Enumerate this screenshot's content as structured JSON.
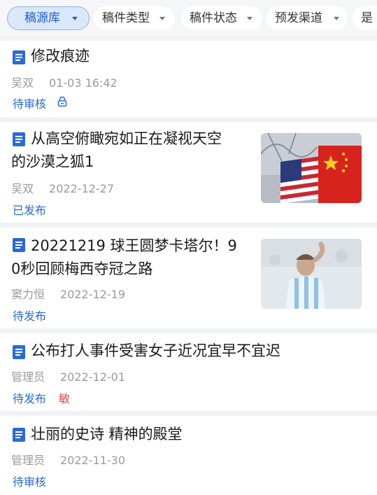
{
  "filters": [
    {
      "label": "稿源库",
      "active": true
    },
    {
      "label": "稿件类型",
      "active": false
    },
    {
      "label": "稿件状态",
      "active": false
    },
    {
      "label": "预发渠道",
      "active": false
    },
    {
      "label": "是",
      "active": false
    }
  ],
  "articles": [
    {
      "title_lines": [
        "修改痕迹"
      ],
      "author": "吴双",
      "date": "01-03 16:42",
      "status": "待审核",
      "locked": true
    },
    {
      "title_lines": [
        "从高空俯瞰宛如正在凝视天空",
        "的沙漠之狐1"
      ],
      "author": "吴双",
      "date": "2022-12-27",
      "status": "已发布",
      "thumbnail": "flags-photo"
    },
    {
      "title_lines": [
        "20221219 球王圆梦卡塔尔！9",
        "0秒回顾梅西夺冠之路"
      ],
      "author": "窦力恒",
      "date": "2022-12-19",
      "status": "待发布",
      "thumbnail": "player-photo"
    },
    {
      "title_lines": [
        "公布打人事件受害女子近况宜早不宜迟"
      ],
      "author": "管理员",
      "date": "2022-12-01",
      "status": "待发布",
      "sensitive_label": "敏"
    },
    {
      "title_lines": [
        "壮丽的史诗 精神的殿堂"
      ],
      "author": "管理员",
      "date": "2022-11-30",
      "status": "待审核"
    }
  ],
  "colors": {
    "accent": "#2a6ad6",
    "sensitive": "#e04848",
    "meta": "#9a9a9a"
  }
}
